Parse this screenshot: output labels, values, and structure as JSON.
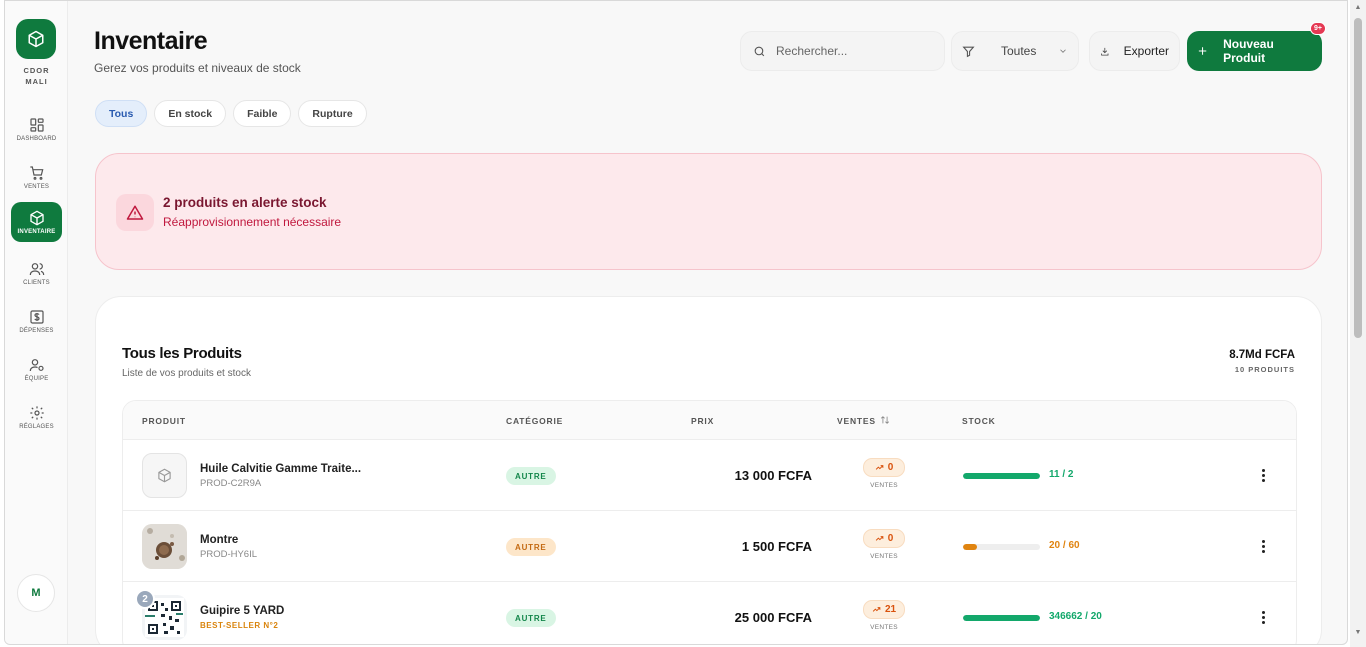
{
  "brand": {
    "line1": "CDOR",
    "line2": "MALI"
  },
  "sidebar": {
    "items": [
      {
        "label": "DASHBOARD",
        "icon": "dashboard-icon"
      },
      {
        "label": "VENTES",
        "icon": "cart-icon"
      },
      {
        "label": "INVENTAIRE",
        "icon": "box-icon",
        "active": true
      },
      {
        "label": "CLIENTS",
        "icon": "users-icon"
      },
      {
        "label": "DÉPENSES",
        "icon": "dollar-icon"
      },
      {
        "label": "ÉQUIPE",
        "icon": "team-icon"
      },
      {
        "label": "RÉGLAGES",
        "icon": "gear-icon"
      }
    ],
    "avatar": "M"
  },
  "header": {
    "title": "Inventaire",
    "subtitle": "Gerez vos produits et niveaux de stock",
    "search_placeholder": "Rechercher...",
    "filter_value": "Toutes",
    "export_label": "Exporter",
    "new_label": "Nouveau Produit",
    "notif_badge": "9+"
  },
  "tabs": [
    "Tous",
    "En stock",
    "Faible",
    "Rupture"
  ],
  "alert": {
    "title": "2 produits en alerte stock",
    "subtitle": "Réapprovisionnement nécessaire"
  },
  "products_card": {
    "title": "Tous les Produits",
    "subtitle": "Liste de vos produits et stock",
    "total": "8.7Md FCFA",
    "count": "10 PRODUITS",
    "columns": {
      "product": "PRODUIT",
      "category": "CATÉGORIE",
      "price": "PRIX",
      "sales": "VENTES",
      "stock": "STOCK"
    },
    "sales_sub": "VENTES",
    "rows": [
      {
        "name": "Huile Calvitie Gamme Traite...",
        "sku": "PROD-C2R9A",
        "category": "AUTRE",
        "price": "13 000 FCFA",
        "sales": "0",
        "stock": "11 / 2",
        "stock_level": 1.0,
        "color": "#13a86b"
      },
      {
        "name": "Montre",
        "sku": "PROD-HY6IL",
        "category": "AUTRE",
        "price": "1 500 FCFA",
        "sales": "0",
        "stock": "20 / 60",
        "stock_level": 0.18,
        "color": "#e08410"
      },
      {
        "name": "Guipire 5 YARD",
        "best": "BEST-SELLER N°2",
        "rank": "2",
        "category": "AUTRE",
        "price": "25 000 FCFA",
        "sales": "21",
        "stock": "346662 / 20",
        "stock_level": 1.0,
        "color": "#13a86b"
      }
    ]
  },
  "colors": {
    "primary": "#0f7a3e",
    "alert_bg": "#fde9ec",
    "alert_text": "#c0183e"
  }
}
